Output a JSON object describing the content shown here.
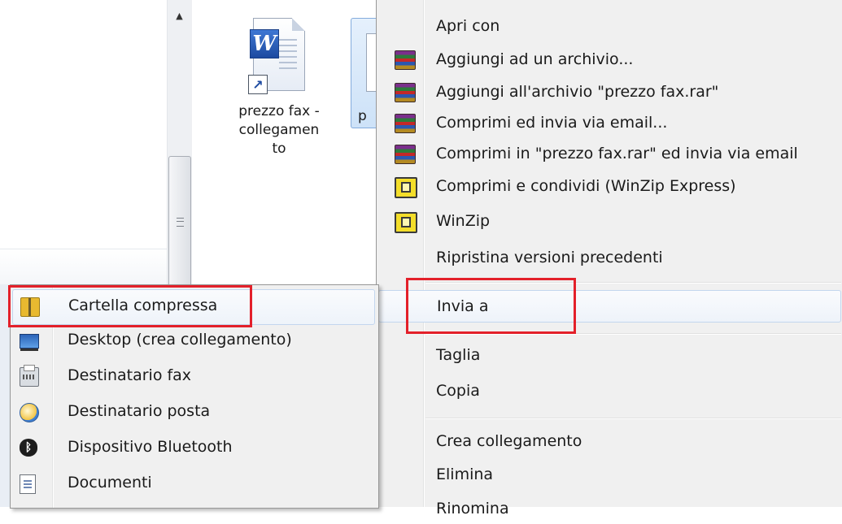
{
  "file_list": {
    "items": [
      {
        "name_lines": [
          "prezzo fax -",
          "collegamen",
          "to"
        ],
        "icon": "word-document-shortcut-icon"
      },
      {
        "name_partial": "p",
        "icon": "document-icon"
      }
    ]
  },
  "context_menu": {
    "items": [
      {
        "label": "Apri con",
        "icon": null
      },
      {
        "label": "Aggiungi ad un archivio...",
        "icon": "winrar-icon"
      },
      {
        "label": "Aggiungi all'archivio \"prezzo fax.rar\"",
        "icon": "winrar-icon"
      },
      {
        "label": "Comprimi ed invia via email...",
        "icon": "winrar-icon"
      },
      {
        "label": "Comprimi in \"prezzo fax.rar\" ed invia via email",
        "icon": "winrar-icon"
      },
      {
        "label": "Comprimi e condividi (WinZip Express)",
        "icon": "winzip-icon"
      },
      {
        "label": "WinZip",
        "icon": "winzip-icon"
      },
      {
        "label": "Ripristina versioni precedenti",
        "icon": null
      },
      {
        "label": "Invia a",
        "icon": null,
        "highlighted": true
      },
      {
        "label": "Taglia",
        "icon": null
      },
      {
        "label": "Copia",
        "icon": null
      },
      {
        "label": "Crea collegamento",
        "icon": null
      },
      {
        "label": "Elimina",
        "icon": null
      },
      {
        "label": "Rinomina",
        "icon": null
      }
    ]
  },
  "sendto_menu": {
    "items": [
      {
        "label": "Cartella compressa",
        "icon": "zip-folder-icon",
        "highlighted": true
      },
      {
        "label": "Desktop (crea collegamento)",
        "icon": "desktop-icon"
      },
      {
        "label": "Destinatario fax",
        "icon": "fax-icon"
      },
      {
        "label": "Destinatario posta",
        "icon": "mail-icon"
      },
      {
        "label": "Dispositivo Bluetooth",
        "icon": "bluetooth-icon"
      },
      {
        "label": "Documenti",
        "icon": "documents-icon"
      }
    ]
  },
  "colors": {
    "menu_background": "#f0f0f0",
    "hover_highlight": "#eef3fa",
    "annotation_red": "#e3202a",
    "selection_blue": "#cde2f8"
  }
}
